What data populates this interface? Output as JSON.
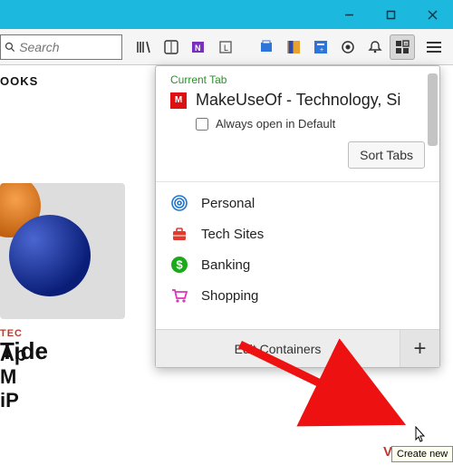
{
  "window": {
    "controls": {
      "min": "minimize",
      "max": "restore",
      "close": "close"
    }
  },
  "toolbar": {
    "search_placeholder": "Search",
    "icons": [
      "library",
      "reader",
      "onenote",
      "pocket-L",
      "clip",
      "sidebar",
      "reader-mode",
      "addon",
      "notify",
      "containers"
    ]
  },
  "page": {
    "header_fragment": "OOKS",
    "tide_fragment": "Tide",
    "viewall": "VIEW AL",
    "article": {
      "category_fragment": "TEC",
      "title_lines": [
        "Ap",
        "M",
        "iP"
      ]
    }
  },
  "popup": {
    "current_tab_label": "Current Tab",
    "tab_title": "MakeUseOf - Technology, Si",
    "always_open_label": "Always open in Default",
    "sort_label": "Sort Tabs",
    "containers": [
      {
        "name": "Personal",
        "color": "#1f74d1",
        "icon": "fingerprint"
      },
      {
        "name": "Tech Sites",
        "color": "#e23b2e",
        "icon": "briefcase"
      },
      {
        "name": "Banking",
        "color": "#1aaa1a",
        "icon": "dollar"
      },
      {
        "name": "Shopping",
        "color": "#d838b7",
        "icon": "cart"
      }
    ],
    "edit_label": "Edit Containers",
    "add_icon_name": "plus-icon",
    "tooltip": "Create new"
  }
}
